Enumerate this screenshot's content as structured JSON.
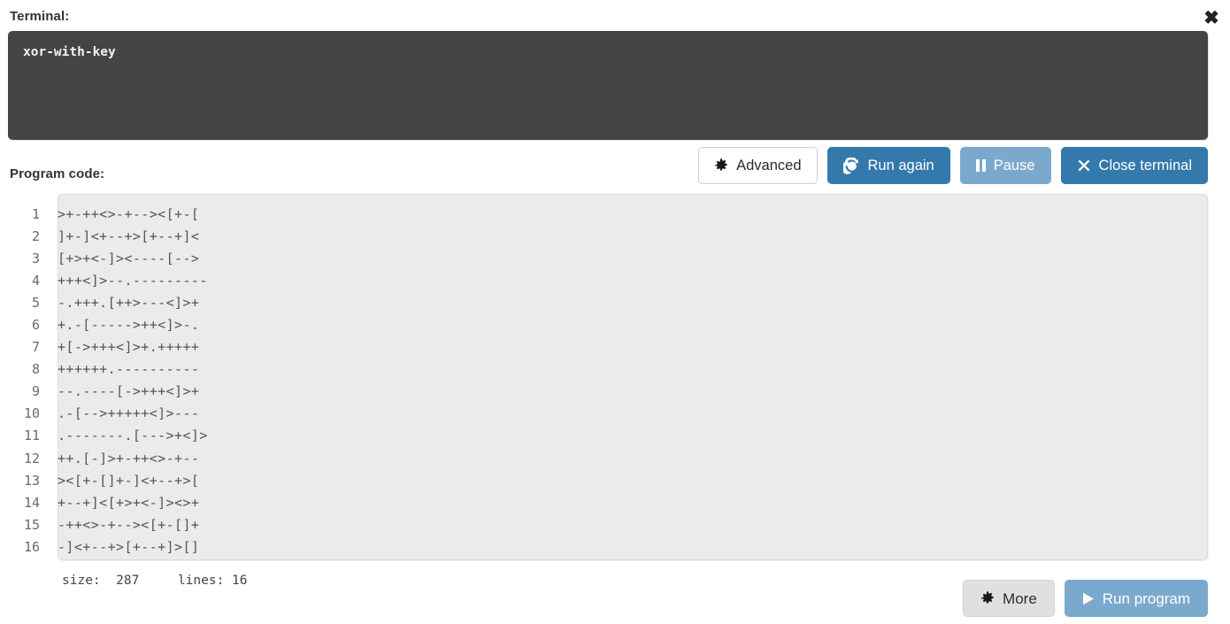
{
  "window": {
    "close_icon": "close-icon",
    "close_glyph": "✖"
  },
  "terminal": {
    "label": "Terminal:",
    "output": "xor-with-key",
    "background": "#454442"
  },
  "program": {
    "label": "Program code:"
  },
  "toolbar": {
    "advanced_label": "Advanced",
    "advanced_icon": "gear-icon",
    "advanced_glyph": "✿",
    "run_again_label": "Run again",
    "run_again_icon": "refresh-icon",
    "run_again_glyph": "⟳",
    "pause_label": "Pause",
    "pause_icon": "pause-icon",
    "close_terminal_label": "Close terminal",
    "close_terminal_icon": "close-icon",
    "close_terminal_glyph": "✖"
  },
  "editor": {
    "lines": [
      {
        "no": "1",
        "code": ">+-++<>-+--><[+-["
      },
      {
        "no": "2",
        "code": "]+-]<+--+>[+--+]<"
      },
      {
        "no": "3",
        "code": "[+>+<-]><----[-->"
      },
      {
        "no": "4",
        "code": "+++<]>--.---------"
      },
      {
        "no": "5",
        "code": "-.+++.[++>---<]>+"
      },
      {
        "no": "6",
        "code": "+.-[----->++<]>-."
      },
      {
        "no": "7",
        "code": "+[->+++<]>+.+++++"
      },
      {
        "no": "8",
        "code": "++++++.----------"
      },
      {
        "no": "9",
        "code": "--.----[->+++<]>+"
      },
      {
        "no": "10",
        "code": ".-[-->+++++<]>---"
      },
      {
        "no": "11",
        "code": ".-------.[--->+<]>"
      },
      {
        "no": "12",
        "code": "++.[-]>+-++<>-+--"
      },
      {
        "no": "13",
        "code": "><[+-[]+-]<+--+>["
      },
      {
        "no": "14",
        "code": "+--+]<[+>+<-]><>+"
      },
      {
        "no": "15",
        "code": "-++<>-+--><[+-[]+"
      },
      {
        "no": "16",
        "code": "-]<+--+>[+--+]>[]"
      }
    ]
  },
  "status": {
    "size_label": "size:",
    "size_value": "287",
    "lines_label": "lines:",
    "lines_value": "16",
    "text": "size:  287     lines: 16"
  },
  "bottom": {
    "more_label": "More",
    "more_icon": "gear-icon",
    "more_glyph": "✿",
    "run_program_label": "Run program",
    "run_program_icon": "play-icon",
    "run_program_glyph": "▶"
  },
  "colors": {
    "primary_blue": "#3479ab",
    "light_blue": "#7ba9cd",
    "terminal_bg": "#454442",
    "code_bg": "#ebebeb",
    "grey_button": "#e0e0e0"
  }
}
